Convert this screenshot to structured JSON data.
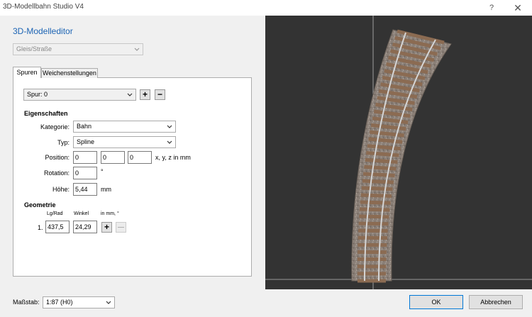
{
  "window": {
    "title": "3D-Modellbahn Studio V4",
    "help": "?",
    "close": "✕"
  },
  "editor": {
    "heading": "3D-Modelleditor",
    "object_type": "Gleis/Straße"
  },
  "tabs": [
    {
      "label": "Spuren"
    },
    {
      "label": "Weichenstellungen"
    }
  ],
  "spur": {
    "selected": "Spur: 0",
    "add": "+",
    "remove": "−"
  },
  "properties": {
    "section": "Eigenschaften",
    "kategorie": {
      "label": "Kategorie:",
      "value": "Bahn"
    },
    "typ": {
      "label": "Typ:",
      "value": "Spline"
    },
    "position": {
      "label": "Position:",
      "x": "0",
      "y": "0",
      "z": "0",
      "unit": "x, y, z in mm"
    },
    "rotation": {
      "label": "Rotation:",
      "value": "0",
      "unit": "°"
    },
    "hoehe": {
      "label": "Höhe:",
      "value": "5,44",
      "unit": "mm"
    }
  },
  "geometry": {
    "section": "Geometrie",
    "col_radius": "Lg/Rad",
    "col_angle": "Winkel",
    "col_unit": "in mm, °",
    "rows": [
      {
        "index": "1.",
        "radius": "437,5",
        "angle": "24,29"
      }
    ],
    "add": "+",
    "remove": "—"
  },
  "footer": {
    "scale_label": "Maßstab:",
    "scale_value": "1:87 (H0)",
    "ok": "OK",
    "cancel": "Abbrechen"
  },
  "colors": {
    "accent": "#1c64b4",
    "viewport_bg": "#333333",
    "track_bed": "#8a7f77",
    "rail": "#c9c9c9",
    "sleeper": "#8b6b52"
  }
}
